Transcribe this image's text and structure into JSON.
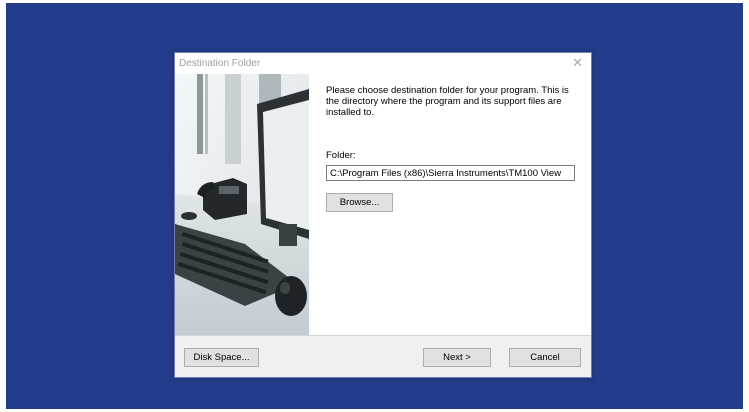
{
  "dialog": {
    "title": "Destination Folder",
    "close_glyph": "✕",
    "intro": "Please choose destination folder for your program. This is the directory where the program and its support files are installed to.",
    "folder_label": "Folder:",
    "folder_value": "C:\\Program Files (x86)\\Sierra Instruments\\TM100 View",
    "browse_label": "Browse...",
    "disk_space_label": "Disk Space...",
    "next_label": "Next >",
    "cancel_label": "Cancel",
    "side_image": "office-desk-photo"
  },
  "colors": {
    "desktop_background": "#233d8c",
    "dialog_background": "#ffffff",
    "footer_background": "#f0f0f0",
    "button_face": "#e1e1e1"
  }
}
